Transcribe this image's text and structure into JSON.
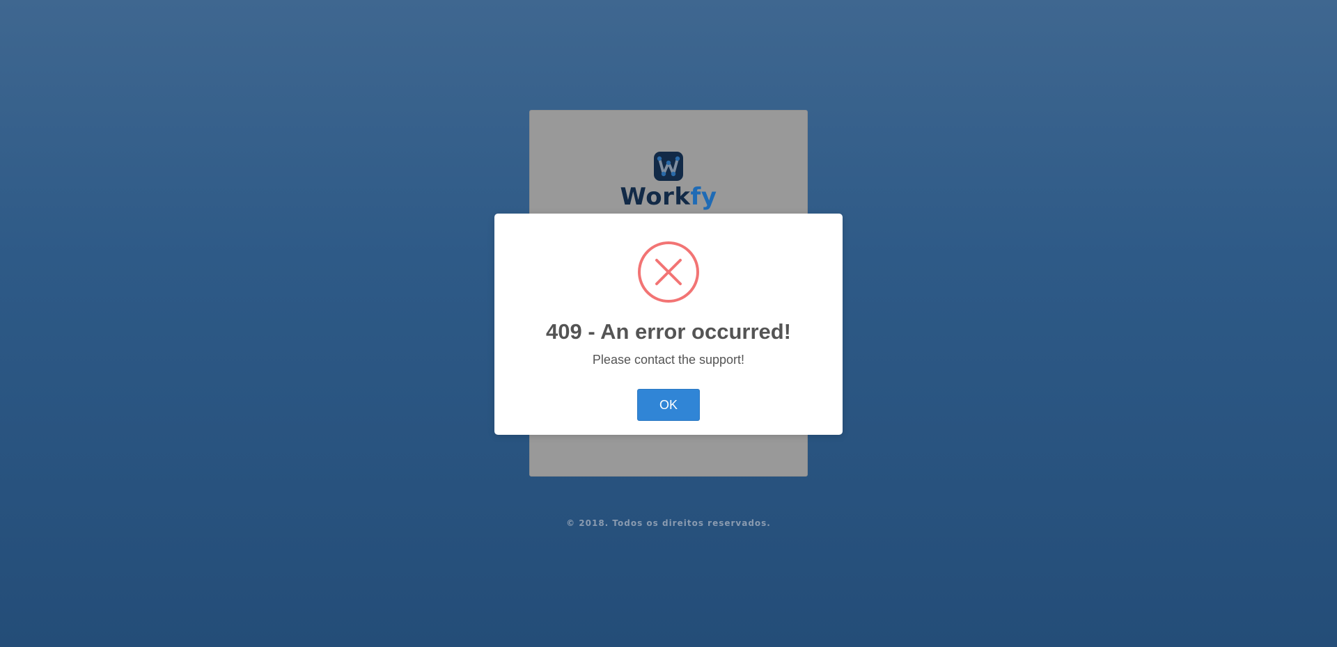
{
  "brand": {
    "name_part_a": "Work",
    "name_part_b": "fy",
    "logo_icon": "workfy-logo-icon"
  },
  "footer": {
    "copyright": "© 2018. Todos os direitos reservados."
  },
  "modal": {
    "icon": "error-x-circle-icon",
    "title": "409 - An error occurred!",
    "text": "Please contact the support!",
    "confirm_label": "OK"
  },
  "colors": {
    "error": "#f27474",
    "confirm_button": "#3085d6",
    "brand_dark": "#122a47",
    "brand_blue": "#1f6bb5"
  }
}
